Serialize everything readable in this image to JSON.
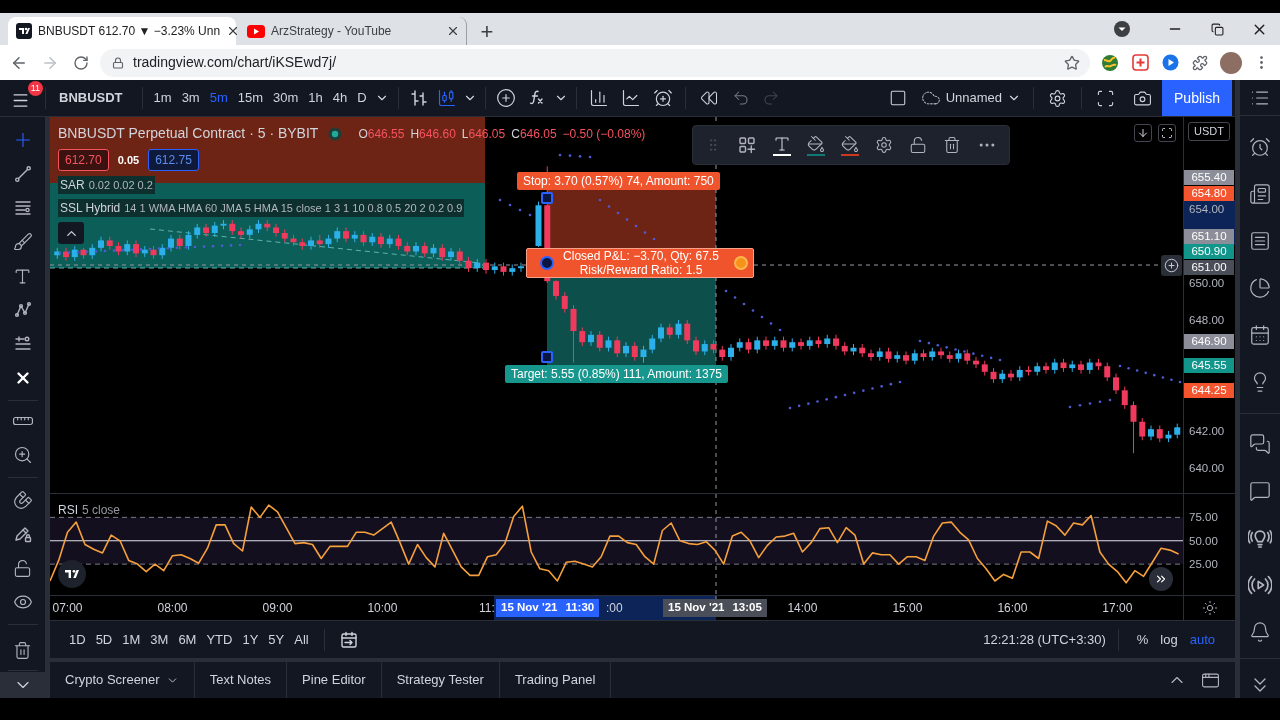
{
  "browser": {
    "tabs": [
      {
        "kind": "tradingview",
        "title": "BNBUSDT 612.70 ▼ −3.23% Unn",
        "selected": true
      },
      {
        "kind": "youtube",
        "title": "ArzStrategy - YouTube",
        "selected": false
      }
    ],
    "new_tab": "+",
    "url": "tradingview.com/chart/iKSEwd7j/"
  },
  "toolbar": {
    "menu_badge": "11",
    "symbol": "BNBUSDT",
    "intervals": [
      {
        "label": "1m",
        "selected": false
      },
      {
        "label": "3m",
        "selected": false
      },
      {
        "label": "5m",
        "selected": true
      },
      {
        "label": "15m",
        "selected": false
      },
      {
        "label": "30m",
        "selected": false
      },
      {
        "label": "1h",
        "selected": false
      },
      {
        "label": "4h",
        "selected": false
      },
      {
        "label": "D",
        "selected": false
      }
    ],
    "layout_name": "Unnamed",
    "publish": "Publish"
  },
  "legend": {
    "title": "BNBUSDT Perpetual Contract · 5 · BYBIT",
    "ohlc": [
      {
        "key": "O",
        "value": "646.55"
      },
      {
        "key": "H",
        "value": "646.60"
      },
      {
        "key": "L",
        "value": "646.05"
      },
      {
        "key": "C",
        "value": "646.05"
      }
    ],
    "change": "−0.50 (−0.08%)",
    "sell_price": "612.70",
    "spread": "0.05",
    "buy_price": "612.75",
    "studies": [
      {
        "name": "SAR",
        "params": "0.02 0.02 0.2"
      },
      {
        "name": "SSL Hybrid",
        "params": "14 1 WMA HMA 60 JMA 5 HMA 15 close 1 3 1 10 0.8 0.5 20 2 0.2 0.9"
      }
    ]
  },
  "position": {
    "stop": "Stop: 3.70 (0.57%) 74, Amount: 750",
    "closed_pnl": "Closed P&L: −3.70, Qty: 67.5",
    "ratio": "Risk/Reward Ratio: 1.5",
    "target": "Target: 5.55 (0.85%) 111, Amount: 1375"
  },
  "main_chart": {
    "chart_data": {
      "type": "candlestick",
      "ylim": [
        638.65,
        658.97
      ],
      "yticks": [
        {
          "value": 654,
          "label": "654.00"
        },
        {
          "value": 650,
          "label": "650.00"
        },
        {
          "value": 648,
          "label": "648.00"
        },
        {
          "value": 642,
          "label": "642.00"
        },
        {
          "value": 640,
          "label": "640.00"
        }
      ],
      "categories": [
        null,
        null,
        null,
        null,
        null,
        null,
        null,
        null,
        null,
        null,
        null,
        null,
        null,
        null,
        null,
        null,
        null,
        null,
        null,
        null,
        null,
        null,
        null,
        null,
        null,
        null,
        null,
        null,
        null,
        null,
        null,
        null,
        null,
        null,
        null,
        null,
        null,
        null,
        null,
        null,
        null,
        null,
        null,
        null,
        null,
        null,
        null,
        null,
        null,
        null,
        null,
        null,
        null,
        null,
        null,
        null,
        null,
        null,
        null,
        null,
        null,
        null,
        null,
        null,
        null,
        null,
        null,
        null,
        null,
        null,
        null,
        null,
        null,
        null,
        null,
        null,
        null,
        null,
        null,
        null,
        null,
        null,
        null,
        null,
        null,
        null,
        null,
        null,
        null,
        null,
        null,
        null,
        null,
        null,
        null,
        null,
        null,
        null,
        null,
        null,
        null,
        null,
        null,
        null,
        null,
        null,
        null,
        null,
        null,
        null,
        null,
        null,
        null,
        null,
        null,
        null,
        null,
        null,
        null,
        null,
        null,
        null,
        null,
        null,
        null,
        null,
        null,
        null,
        null
      ],
      "ohlc": [
        [
          651.5,
          651.9,
          651.3,
          651.7
        ],
        [
          651.7,
          651.9,
          651.2,
          651.4
        ],
        [
          651.4,
          652.0,
          651.2,
          651.8
        ],
        [
          651.8,
          651.9,
          651.3,
          651.5
        ],
        [
          651.5,
          652.1,
          651.3,
          651.9
        ],
        [
          651.9,
          652.5,
          651.7,
          652.3
        ],
        [
          652.3,
          652.5,
          651.8,
          652.0
        ],
        [
          652.0,
          652.2,
          651.5,
          651.7
        ],
        [
          651.7,
          652.3,
          651.5,
          652.1
        ],
        [
          652.1,
          652.3,
          651.4,
          651.6
        ],
        [
          651.6,
          652.0,
          651.4,
          651.8
        ],
        [
          651.8,
          652.0,
          651.3,
          651.5
        ],
        [
          651.5,
          652.1,
          651.3,
          651.9
        ],
        [
          651.9,
          652.6,
          651.7,
          652.4
        ],
        [
          652.4,
          652.6,
          651.8,
          652.0
        ],
        [
          652.0,
          652.8,
          651.8,
          652.6
        ],
        [
          652.6,
          653.2,
          652.4,
          653.0
        ],
        [
          653.0,
          653.2,
          652.5,
          652.7
        ],
        [
          652.7,
          653.3,
          652.5,
          653.1
        ],
        [
          653.1,
          653.4,
          652.9,
          653.2
        ],
        [
          653.2,
          653.4,
          652.6,
          652.8
        ],
        [
          652.8,
          653.0,
          652.4,
          652.6
        ],
        [
          652.6,
          653.1,
          652.4,
          652.9
        ],
        [
          652.9,
          653.4,
          652.7,
          653.2
        ],
        [
          653.2,
          653.4,
          652.8,
          653.0
        ],
        [
          653.0,
          653.2,
          652.5,
          652.7
        ],
        [
          652.7,
          652.9,
          652.2,
          652.4
        ],
        [
          652.4,
          652.6,
          652.0,
          652.2
        ],
        [
          652.2,
          652.4,
          651.8,
          652.0
        ],
        [
          652.0,
          652.5,
          651.8,
          652.3
        ],
        [
          652.3,
          652.6,
          651.9,
          652.1
        ],
        [
          652.1,
          652.6,
          651.9,
          652.4
        ],
        [
          652.4,
          653.0,
          652.2,
          652.8
        ],
        [
          652.8,
          653.0,
          652.2,
          652.4
        ],
        [
          652.4,
          652.8,
          652.2,
          652.6
        ],
        [
          652.6,
          652.8,
          652.0,
          652.2
        ],
        [
          652.2,
          652.7,
          652.0,
          652.5
        ],
        [
          652.5,
          652.7,
          651.9,
          652.1
        ],
        [
          652.1,
          652.6,
          651.9,
          652.4
        ],
        [
          652.4,
          652.6,
          651.8,
          652.0
        ],
        [
          652.0,
          652.2,
          651.5,
          651.7
        ],
        [
          651.7,
          652.2,
          651.5,
          652.0
        ],
        [
          652.0,
          652.2,
          651.4,
          651.6
        ],
        [
          651.6,
          652.1,
          651.4,
          651.9
        ],
        [
          651.9,
          652.1,
          651.2,
          651.4
        ],
        [
          651.4,
          651.9,
          651.2,
          651.7
        ],
        [
          651.7,
          651.9,
          651.0,
          651.2
        ],
        [
          651.2,
          651.4,
          650.6,
          650.8
        ],
        [
          650.8,
          651.3,
          650.6,
          651.1
        ],
        [
          651.1,
          651.3,
          650.5,
          650.7
        ],
        [
          650.7,
          651.1,
          650.5,
          650.9
        ],
        [
          650.9,
          651.1,
          650.4,
          650.6
        ],
        [
          650.6,
          651.0,
          650.4,
          650.8
        ],
        [
          650.8,
          651.1,
          650.6,
          650.9
        ],
        null,
        [
          652.0,
          654.4,
          651.95,
          654.2
        ],
        [
          654.2,
          656.3,
          650.0,
          650.1
        ],
        [
          650.1,
          650.15,
          649.1,
          649.3
        ],
        [
          649.3,
          649.5,
          648.4,
          648.6
        ],
        [
          648.6,
          648.8,
          645.7,
          647.4
        ],
        [
          647.4,
          647.6,
          646.6,
          646.8
        ],
        [
          646.8,
          647.4,
          646.6,
          647.2
        ],
        [
          647.2,
          647.4,
          646.3,
          646.5
        ],
        [
          646.5,
          647.1,
          646.3,
          646.9
        ],
        [
          646.9,
          647.1,
          646.0,
          646.2
        ],
        [
          646.2,
          646.8,
          646.0,
          646.6
        ],
        [
          646.6,
          646.8,
          645.8,
          646.0
        ],
        [
          646.0,
          646.6,
          645.7,
          646.4
        ],
        [
          646.4,
          647.2,
          646.2,
          647.0
        ],
        [
          647.0,
          647.8,
          646.8,
          647.6
        ],
        [
          647.6,
          647.8,
          647.0,
          647.2
        ],
        [
          647.2,
          648.0,
          647.0,
          647.8
        ],
        [
          647.8,
          648.0,
          646.7,
          646.9
        ],
        [
          646.9,
          647.1,
          646.1,
          646.3
        ],
        [
          646.3,
          646.9,
          646.1,
          646.7
        ],
        [
          646.7,
          646.9,
          646.2,
          646.4
        ],
        [
          646.4,
          646.6,
          645.8,
          646.0
        ],
        [
          646.0,
          646.7,
          645.8,
          646.5
        ],
        [
          646.5,
          647.0,
          646.3,
          646.8
        ],
        [
          646.8,
          647.0,
          646.2,
          646.4
        ],
        [
          646.4,
          647.1,
          646.2,
          646.9
        ],
        [
          646.9,
          647.1,
          646.4,
          646.6
        ],
        [
          646.6,
          647.1,
          646.4,
          646.9
        ],
        [
          646.9,
          647.1,
          646.3,
          646.5
        ],
        [
          646.5,
          647.0,
          646.3,
          646.8
        ],
        [
          646.8,
          647.0,
          646.4,
          646.6
        ],
        [
          646.6,
          647.1,
          646.4,
          646.9
        ],
        [
          646.9,
          647.1,
          646.5,
          646.7
        ],
        [
          646.7,
          647.2,
          646.5,
          647.0
        ],
        [
          647.0,
          647.2,
          646.4,
          646.6
        ],
        [
          646.6,
          646.8,
          646.1,
          646.3
        ],
        [
          646.3,
          646.7,
          646.1,
          646.5
        ],
        [
          646.5,
          646.7,
          646.0,
          646.2
        ],
        [
          646.2,
          646.4,
          645.8,
          646.0
        ],
        [
          646.0,
          646.5,
          645.8,
          646.3
        ],
        [
          646.3,
          646.5,
          645.7,
          645.9
        ],
        [
          645.9,
          646.3,
          645.7,
          646.1
        ],
        [
          646.1,
          646.3,
          645.6,
          645.8
        ],
        [
          645.8,
          646.4,
          645.6,
          646.2
        ],
        [
          646.2,
          646.4,
          645.8,
          646.0
        ],
        [
          646.0,
          646.5,
          645.8,
          646.3
        ],
        [
          646.3,
          646.5,
          645.9,
          646.1
        ],
        [
          646.1,
          646.3,
          645.7,
          645.9
        ],
        [
          645.9,
          646.4,
          645.7,
          646.2
        ],
        [
          646.2,
          646.4,
          645.6,
          645.8
        ],
        [
          645.8,
          646.0,
          645.4,
          645.6
        ],
        [
          645.6,
          645.8,
          645.0,
          645.2
        ],
        [
          645.2,
          645.4,
          644.6,
          644.8
        ],
        [
          644.8,
          645.3,
          644.6,
          645.1
        ],
        [
          645.1,
          645.3,
          644.7,
          644.9
        ],
        [
          644.9,
          645.5,
          644.7,
          645.3
        ],
        [
          645.3,
          645.5,
          645.0,
          645.2
        ],
        [
          645.2,
          645.7,
          645.0,
          645.5
        ],
        [
          645.5,
          645.7,
          645.1,
          645.3
        ],
        [
          645.3,
          645.9,
          645.1,
          645.7
        ],
        [
          645.7,
          645.9,
          645.2,
          645.4
        ],
        [
          645.4,
          645.8,
          645.2,
          645.6
        ],
        [
          645.6,
          645.8,
          645.1,
          645.3
        ],
        [
          645.3,
          645.9,
          645.1,
          645.7
        ],
        [
          645.7,
          645.9,
          645.3,
          645.5
        ],
        [
          645.5,
          645.7,
          644.7,
          644.9
        ],
        [
          644.9,
          645.1,
          644.0,
          644.2
        ],
        [
          644.2,
          644.4,
          643.2,
          643.4
        ],
        [
          643.4,
          643.6,
          640.8,
          642.5
        ],
        [
          642.5,
          642.7,
          641.5,
          641.7
        ],
        [
          641.7,
          642.3,
          641.5,
          642.1
        ],
        [
          642.1,
          642.3,
          641.4,
          641.6
        ],
        [
          641.6,
          642.0,
          641.4,
          641.8
        ],
        [
          641.8,
          642.4,
          641.6,
          642.2
        ]
      ]
    }
  },
  "price_axis": {
    "currency": "USDT",
    "tags": [
      {
        "text": "655.40",
        "color": "#8b8e98"
      },
      {
        "text": "654.80",
        "color": "#f4552f"
      },
      {
        "text": "651.10",
        "color": "#8b8e98"
      },
      {
        "text": "650.90",
        "color": "#12968b"
      },
      {
        "text": "651.00",
        "color": "#4a4e58"
      },
      {
        "text": "646.90",
        "color": "#8b8e98"
      },
      {
        "text": "645.55",
        "color": "#12968b"
      },
      {
        "text": "644.25",
        "color": "#f4552f"
      }
    ]
  },
  "rsi": {
    "params": "5 close",
    "chart_data": {
      "type": "line",
      "ylim": [
        -8,
        100
      ],
      "categories": [
        null,
        null,
        "07:00",
        null,
        null,
        null,
        null,
        null,
        null,
        null,
        null,
        null,
        null,
        null,
        "08:00",
        null,
        null,
        null,
        null,
        null,
        null,
        null,
        null,
        null,
        null,
        null,
        "09:00",
        null,
        null,
        null,
        null,
        null,
        null,
        null,
        null,
        null,
        null,
        null,
        "10:00",
        null,
        null,
        null,
        null,
        null,
        null,
        null,
        null,
        null,
        null,
        null,
        null,
        null,
        null,
        null,
        null,
        null,
        null,
        null,
        null,
        null,
        null,
        null,
        null,
        null,
        null,
        null,
        null,
        null,
        null,
        null,
        null,
        null,
        null,
        null,
        null,
        null,
        null,
        null,
        null,
        null,
        null,
        null,
        null,
        null,
        null,
        null,
        "14:00",
        null,
        null,
        null,
        null,
        null,
        null,
        null,
        null,
        null,
        null,
        null,
        "15:00",
        null,
        null,
        null,
        null,
        null,
        null,
        null,
        null,
        null,
        null,
        null,
        "16:00",
        null,
        null,
        null,
        null,
        null,
        null,
        null,
        null,
        null,
        null,
        null,
        "17:00",
        null,
        null,
        null,
        null,
        null,
        null,
        null
      ],
      "yticks": [
        {
          "value": 75,
          "label": "75.00"
        },
        {
          "value": 50,
          "label": "50.00"
        },
        {
          "value": 25,
          "label": "25.00"
        }
      ],
      "series": [
        {
          "name": "RSI",
          "color": "#f5a03c",
          "values": [
            7,
            29,
            59,
            70,
            46,
            41,
            37,
            56,
            50,
            29,
            25,
            17,
            25,
            18,
            34,
            35,
            31,
            26,
            42,
            67,
            67,
            47,
            39,
            86,
            75,
            88,
            81,
            64,
            47,
            48,
            46,
            31,
            44,
            44,
            44,
            59,
            59,
            56,
            63,
            70,
            48,
            25,
            46,
            32,
            22,
            58,
            40,
            22,
            13,
            13,
            33,
            35,
            47,
            76,
            87,
            38,
            20,
            18,
            7,
            27,
            28,
            25,
            22,
            33,
            55,
            55,
            48,
            46,
            33,
            25,
            61,
            69,
            50,
            47,
            46,
            49,
            40,
            25,
            55,
            59,
            50,
            32,
            45,
            54,
            55,
            58,
            38,
            48,
            63,
            64,
            48,
            64,
            56,
            25,
            37,
            35,
            35,
            25,
            33,
            33,
            29,
            55,
            69,
            70,
            59,
            51,
            31,
            20,
            7,
            14,
            10,
            38,
            38,
            31,
            71,
            66,
            56,
            69,
            67,
            77,
            38,
            25,
            17,
            5,
            18,
            12,
            27,
            42,
            40,
            36
          ]
        }
      ]
    }
  },
  "time_axis": {
    "partial_labels": [
      "11:",
      ":00"
    ],
    "tags": [
      {
        "date": "15 Nov '21",
        "time": "11:30",
        "color": "#2962ff"
      },
      {
        "date": "15 Nov '21",
        "time": "13:05",
        "color": "#4a4e58"
      }
    ]
  },
  "range_bar": {
    "ranges": [
      "1D",
      "5D",
      "1M",
      "3M",
      "6M",
      "YTD",
      "1Y",
      "5Y",
      "All"
    ],
    "clock": "12:21:28 (UTC+3:30)",
    "scale_options": [
      {
        "label": "%",
        "selected": false
      },
      {
        "label": "log",
        "selected": false
      },
      {
        "label": "auto",
        "selected": true
      }
    ]
  },
  "bottom_panel": {
    "tabs": [
      {
        "label": "Crypto Screener",
        "kind": "menu"
      },
      {
        "label": "Text Notes",
        "kind": "plain"
      },
      {
        "label": "Pine Editor",
        "kind": "plain"
      },
      {
        "label": "Strategy Tester",
        "kind": "plain"
      },
      {
        "label": "Trading Panel",
        "kind": "plain"
      }
    ]
  }
}
